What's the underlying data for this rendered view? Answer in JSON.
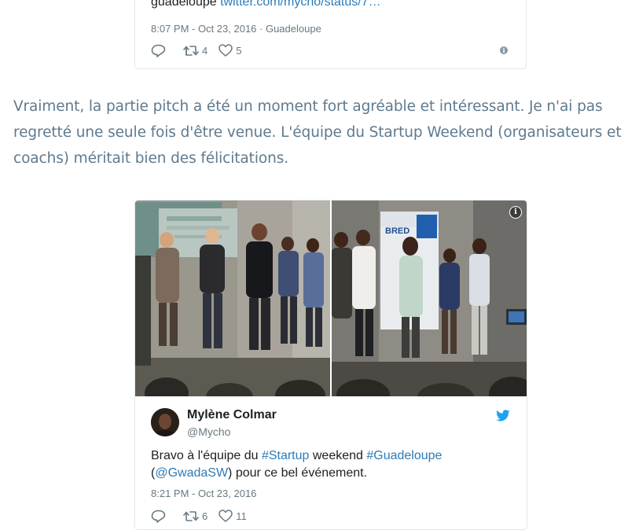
{
  "tweet1": {
    "text_prefix": "guadeloupe ",
    "link": "twitter.com/mycho/status/7…",
    "timestamp": "8:07 PM - Oct 23, 2016",
    "separator": " · ",
    "location": "Guadeloupe",
    "retweets": "4",
    "likes": "5"
  },
  "article": {
    "paragraph": "Vraiment, la partie pitch a été un moment fort agréable et intéressant. Je n'ai pas regretté une seule fois d'être venue. L'équipe du Startup Weekend (organisateurs et coachs) méritait bien des félicitations."
  },
  "tweet2": {
    "author_name": "Mylène Colmar",
    "author_handle": "@Mycho",
    "text_1": "Bravo à l'équipe du ",
    "hashtag_startup": "#Startup",
    "text_2": " weekend ",
    "hashtag_guadeloupe": "#Guadeloupe",
    "text_3": "(",
    "mention": "@GwadaSW",
    "text_4": ") pour ce bel événement.",
    "timestamp": "8:21 PM - Oct 23, 2016",
    "retweets": "6",
    "likes": "11",
    "photo_banner_left": "BRED"
  },
  "colors": {
    "link": "#2b7bb9",
    "meta": "#697882",
    "article_text": "#5e7a8f",
    "twitter_blue": "#1da1f2",
    "card_border": "#e1e8ed"
  },
  "icons": {
    "reply": "reply-icon",
    "retweet": "retweet-icon",
    "like": "heart-icon",
    "info": "info-icon",
    "twitter": "twitter-bird-icon"
  }
}
